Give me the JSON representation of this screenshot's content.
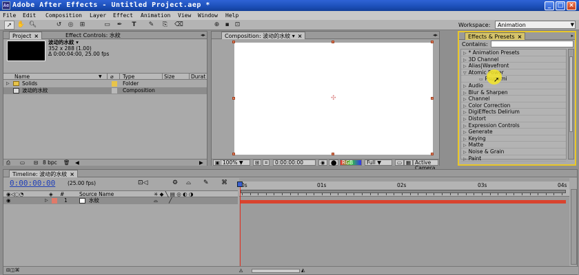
{
  "window": {
    "title": "Adobe After Effects - Untitled Project.aep *",
    "buttons": [
      "_",
      "□",
      "×"
    ]
  },
  "menu": [
    "File",
    "Edit",
    "Composition",
    "Layer",
    "Effect",
    "Animation",
    "View",
    "Window",
    "Help"
  ],
  "toolbar": {
    "workspace_label": "Workspace:",
    "workspace_value": "Animation",
    "tool_icons": [
      "selection-tool-icon",
      "hand-tool-icon",
      "zoom-tool-icon",
      "rotate-tool-icon",
      "camera-tool-icon",
      "pan-behind-tool-icon",
      "mask-tool-icon",
      "pen-tool-icon",
      "type-tool-icon",
      "brush-tool-icon",
      "clone-tool-icon",
      "eraser-tool-icon"
    ]
  },
  "project_panel": {
    "tab_project": "Project",
    "tab_effect_controls": "Effect Controls: 水紋",
    "selected_name": "波动的水紋 ▾",
    "info_line1": "352 x 288 (1.00)",
    "info_line2": "Δ 0:00:04:00, 25.00 fps",
    "columns": [
      "Name",
      "Type",
      "Size",
      "Durat"
    ],
    "rows": [
      {
        "name": "Solids",
        "type": "Folder"
      },
      {
        "name": "波动的水紋",
        "type": "Composition"
      }
    ],
    "bpc": "8 bpc"
  },
  "composition_panel": {
    "tab": "Composition: 波动的水紋",
    "zoom": "100%",
    "timecode": "0:00:00:00",
    "resolution": "Full",
    "camera": "Active Camera"
  },
  "effects_panel": {
    "tab": "Effects & Presets",
    "contains_label": "Contains:",
    "contains_value": "",
    "items": [
      {
        "label": "* Animation Presets",
        "expanded": false,
        "child": false
      },
      {
        "label": "3D Channel",
        "expanded": false,
        "child": false
      },
      {
        "label": "Alias|Wavefront",
        "expanded": false,
        "child": false
      },
      {
        "label": "Atomic Power",
        "expanded": true,
        "child": false
      },
      {
        "label": "Psunami",
        "expanded": false,
        "child": true
      },
      {
        "label": "Audio",
        "expanded": false,
        "child": false
      },
      {
        "label": "Blur & Sharpen",
        "expanded": false,
        "child": false
      },
      {
        "label": "Channel",
        "expanded": false,
        "child": false
      },
      {
        "label": "Color Correction",
        "expanded": false,
        "child": false
      },
      {
        "label": "DigiEffects Delirium",
        "expanded": false,
        "child": false
      },
      {
        "label": "Distort",
        "expanded": false,
        "child": false
      },
      {
        "label": "Expression Controls",
        "expanded": false,
        "child": false
      },
      {
        "label": "Generate",
        "expanded": false,
        "child": false
      },
      {
        "label": "Keying",
        "expanded": false,
        "child": false
      },
      {
        "label": "Matte",
        "expanded": false,
        "child": false
      },
      {
        "label": "Noise & Grain",
        "expanded": false,
        "child": false
      },
      {
        "label": "Paint",
        "expanded": false,
        "child": false
      }
    ],
    "accent": "#e8c628"
  },
  "timeline": {
    "tab": "Timeline: 波动的水紋",
    "current_time": "0:00:00:00",
    "fps": "(25.00 fps)",
    "columns": [
      "#",
      "Source Name"
    ],
    "layer": {
      "number": "1",
      "name": "水紋",
      "color": "#e07a6a"
    },
    "ruler_labels": [
      "0s",
      "01s",
      "02s",
      "03s",
      "04s"
    ],
    "bar_color": "#d9432e"
  }
}
